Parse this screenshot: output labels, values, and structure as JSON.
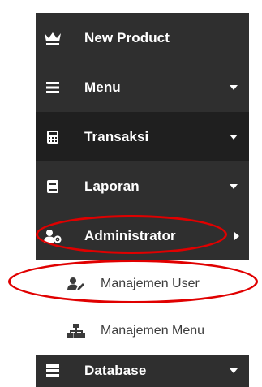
{
  "sidebar": {
    "items": [
      {
        "label": "New Product",
        "icon": "crown-icon"
      },
      {
        "label": "Menu",
        "icon": "list-icon"
      },
      {
        "label": "Transaksi",
        "icon": "calculator-icon"
      },
      {
        "label": "Laporan",
        "icon": "book-icon"
      },
      {
        "label": "Administrator",
        "icon": "users-cog-icon"
      },
      {
        "label": "Database",
        "icon": "server-icon"
      }
    ],
    "subitems": [
      {
        "label": "Manajemen User",
        "icon": "user-edit-icon"
      },
      {
        "label": "Manajemen Menu",
        "icon": "sitemap-icon"
      }
    ]
  },
  "colors": {
    "sidebar_bg": "#2f2f2f",
    "sidebar_dark": "#1f1f1f",
    "highlight": "#e00000",
    "submenu_bg": "#ffffff"
  }
}
